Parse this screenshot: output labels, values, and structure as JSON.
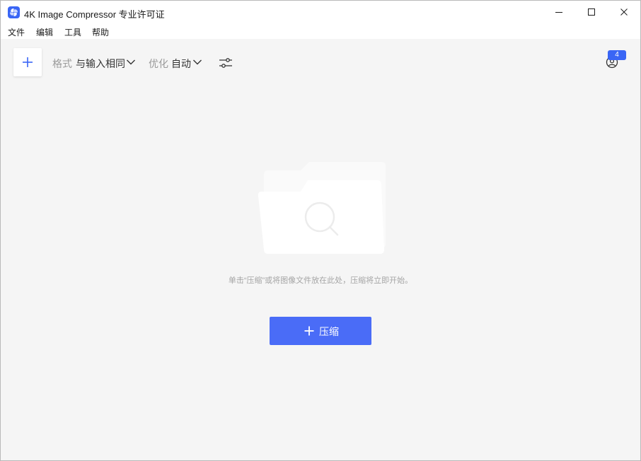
{
  "window": {
    "title": "4K Image Compressor 专业许可证"
  },
  "menu": {
    "file": "文件",
    "edit": "编辑",
    "tools": "工具",
    "help": "帮助"
  },
  "toolbar": {
    "format_label": "格式",
    "format_value": "与输入相同",
    "optimize_label": "优化",
    "optimize_value": "自动",
    "account_badge": "4"
  },
  "main": {
    "hint": "单击“压缩”或将图像文件放在此处，压缩将立即开始。",
    "compress_label": "压缩"
  },
  "colors": {
    "accent": "#4a6cf7",
    "background": "#f5f5f5"
  }
}
